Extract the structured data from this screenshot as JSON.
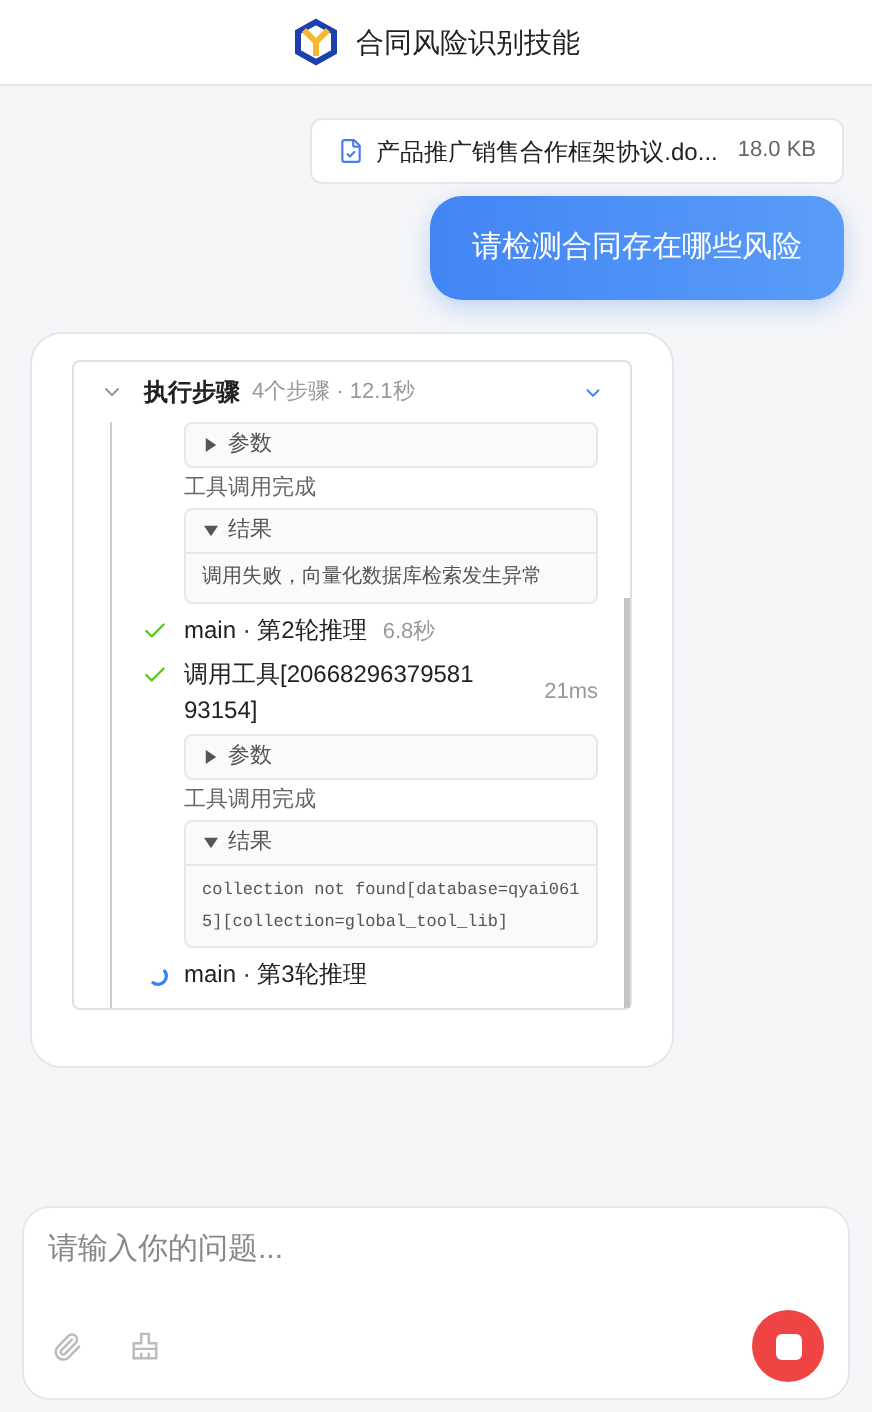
{
  "header": {
    "title": "合同风险识别技能"
  },
  "attachment": {
    "name": "产品推广销售合作框架协议.do...",
    "size": "18.0 KB"
  },
  "user_message": "请检测合同存在哪些风险",
  "steps_panel": {
    "title": "执行步骤",
    "summary": "4个步骤 · 12.1秒",
    "expanded": true,
    "leading_details": [
      {
        "kind": "block",
        "label": "参数",
        "expanded": false
      },
      {
        "kind": "note",
        "text": "工具调用完成"
      },
      {
        "kind": "block",
        "label": "结果",
        "expanded": true,
        "content": "调用失败，向量化数据库检索发生异常",
        "mono": false
      }
    ],
    "steps": [
      {
        "title": "main · 第2轮推理",
        "duration": "6.8秒",
        "done": true
      },
      {
        "title": "调用工具[2066829637958193154]",
        "duration": "21ms",
        "done": true,
        "details": [
          {
            "kind": "block",
            "label": "参数",
            "expanded": false
          },
          {
            "kind": "note",
            "text": "工具调用完成"
          },
          {
            "kind": "block",
            "label": "结果",
            "expanded": true,
            "content": "collection not found[database=qyai0615][collection=global_tool_lib]",
            "mono": true
          }
        ]
      },
      {
        "title": "main · 第3轮推理",
        "done": false
      }
    ]
  },
  "input": {
    "placeholder": "请输入你的问题..."
  }
}
